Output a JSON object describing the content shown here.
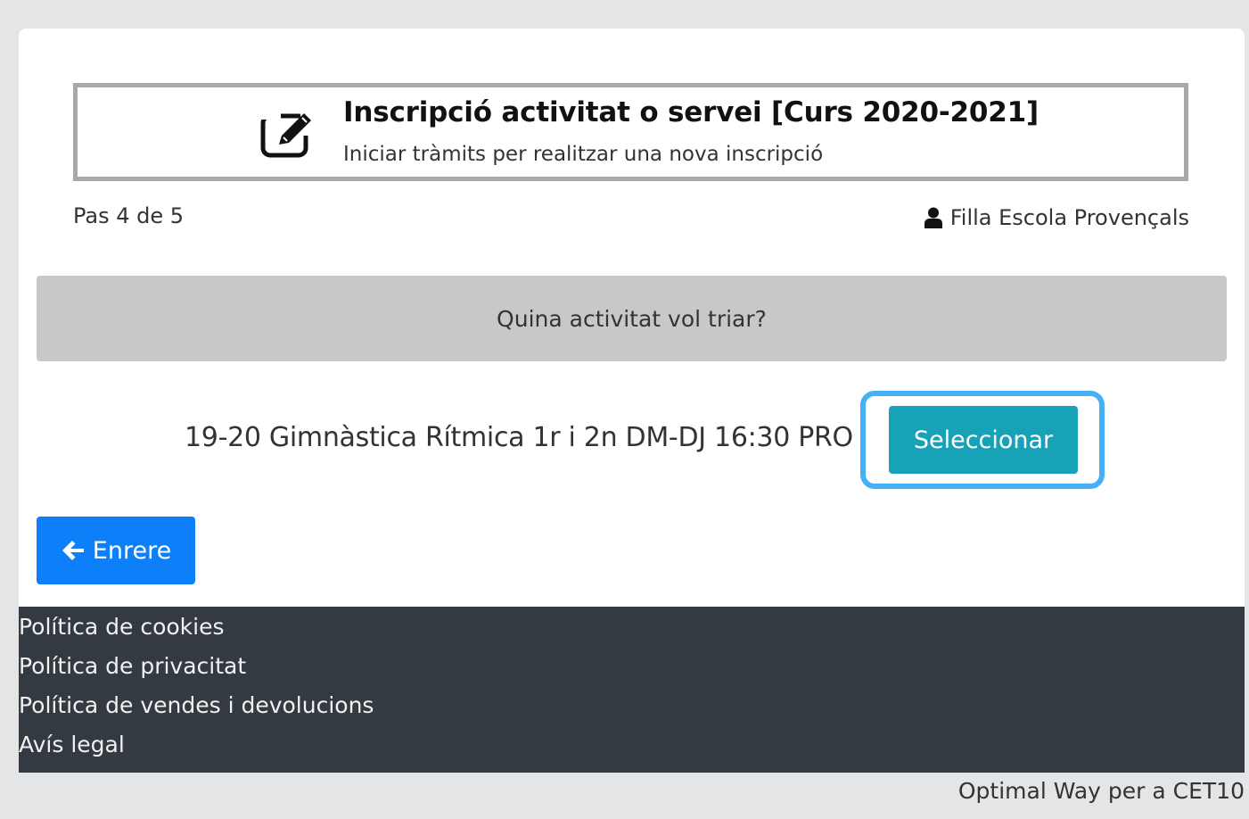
{
  "header": {
    "title": "Inscripció activitat o servei [Curs 2020-2021]",
    "subtitle": "Iniciar tràmits per realitzar una nova inscripció",
    "icon": "edit-icon"
  },
  "step": {
    "label": "Pas 4 de 5"
  },
  "user": {
    "name": "Filla Escola Provençals",
    "icon": "user-icon"
  },
  "question": {
    "text": "Quina activitat vol triar?"
  },
  "activity": {
    "label": "19-20 Gimnàstica Rítmica 1r i 2n DM-DJ 16:30 PRO",
    "select_label": "Seleccionar"
  },
  "navigation": {
    "back_label": "Enrere",
    "back_icon": "arrow-left-icon"
  },
  "footer": {
    "links": [
      "Política de cookies",
      "Política de privacitat",
      "Política de vendes i devolucions",
      "Avís legal"
    ]
  },
  "credits": {
    "text": "Optimal Way per a CET10"
  },
  "colors": {
    "background": "#e4e5e7",
    "question_band": "#c8c8c8",
    "select_button": "#17a2b8",
    "select_highlight": "#45b0f6",
    "back_button": "#0d7ff8",
    "footer": "#343a41"
  }
}
